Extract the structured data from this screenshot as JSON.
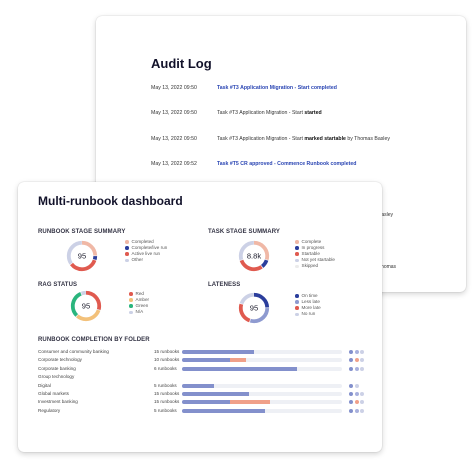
{
  "audit_log": {
    "title": "Audit Log",
    "entries": [
      {
        "date": "May 13, 2022 09:50",
        "text": "Task #T3 Application Migration - Start completed"
      },
      {
        "date": "May 13, 2022 09:50",
        "pre": "Task #T3 Application Migration - Start ",
        "bold": "started"
      },
      {
        "date": "May 13, 2022 09:50",
        "pre": "Task #T3 Application Migration - Start ",
        "bold": "marked startable",
        "post": " by Thomas Basley"
      },
      {
        "date": "May 13, 2022 09:52",
        "text": "Task #T5 CR approved - Commence Runbook completed"
      }
    ],
    "stub_1": "Basley",
    "stub_2": "Thomas"
  },
  "dashboard": {
    "title": "Multi-runbook dashboard",
    "runbook_stage": {
      "heading": "RUNBOOK STAGE SUMMARY",
      "value": "95",
      "legend": [
        "Completed",
        "Complete/live run",
        "Active live run",
        "Other"
      ],
      "colors": [
        "#f0b8a6",
        "#2b3e9c",
        "#e05a4f",
        "#ccd1e6"
      ],
      "fractions": [
        0.25,
        0.05,
        0.35,
        0.35
      ]
    },
    "task_stage": {
      "heading": "TASK STAGE SUMMARY",
      "value": "8.8k",
      "legend": [
        "Complete",
        "In progress",
        "Startable",
        "Not yet startable",
        "Skipped"
      ],
      "colors": [
        "#f0b8a6",
        "#2b3e9c",
        "#e05a4f",
        "#ccd1e6",
        "#ebebeb"
      ],
      "fractions": [
        0.3,
        0.1,
        0.3,
        0.3,
        0
      ]
    },
    "rag_status": {
      "heading": "RAG STATUS",
      "value": "95",
      "legend": [
        "Red",
        "Amber",
        "Green",
        "N/A"
      ],
      "colors": [
        "#e05a4f",
        "#f3c17a",
        "#2ab57d",
        "#ccd1e6"
      ],
      "fractions": [
        0.3,
        0.32,
        0.32,
        0.06
      ]
    },
    "lateness": {
      "heading": "LATENESS",
      "value": "95",
      "legend": [
        "On time",
        "Less late",
        "More late",
        "No run"
      ],
      "colors": [
        "#2b3e9c",
        "#8e9ad0",
        "#e05a4f",
        "#ccd1e6"
      ],
      "fractions": [
        0.25,
        0.3,
        0.25,
        0.2
      ]
    },
    "folders": {
      "heading": "RUNBOOK COMPLETION BY FOLDER",
      "rows": [
        {
          "name": "Consumer and community banking",
          "count": "15 runbooks",
          "segments": [
            {
              "v": 0.45,
              "c": "#8390cc"
            }
          ],
          "dots": [
            "#8390cc",
            "#a9b1dd",
            "#ccd1e6"
          ]
        },
        {
          "name": "Corporate technology",
          "count": "10 runbooks",
          "segments": [
            {
              "v": 0.3,
              "c": "#8390cc"
            },
            {
              "v": 0.1,
              "c": "#f0a089"
            }
          ],
          "dots": [
            "#8390cc",
            "#f0a089",
            "#ccd1e6"
          ]
        },
        {
          "name": "Corporate banking",
          "count": "6 runbooks",
          "segments": [
            {
              "v": 0.72,
              "c": "#8390cc"
            }
          ],
          "dots": [
            "#8390cc",
            "#a9b1dd",
            "#ccd1e6"
          ]
        },
        {
          "name": "Group technology",
          "count": "",
          "segments": [],
          "dots": []
        },
        {
          "name": "Digital",
          "count": "5 runbooks",
          "segments": [
            {
              "v": 0.2,
              "c": "#8390cc"
            }
          ],
          "dots": [
            "#8390cc",
            "#ccd1e6"
          ]
        },
        {
          "name": "Global markets",
          "count": "15 runbooks",
          "segments": [
            {
              "v": 0.42,
              "c": "#8390cc"
            }
          ],
          "dots": [
            "#8390cc",
            "#a9b1dd",
            "#ccd1e6"
          ]
        },
        {
          "name": "Investment banking",
          "count": "15 runbooks",
          "segments": [
            {
              "v": 0.3,
              "c": "#8390cc"
            },
            {
              "v": 0.25,
              "c": "#f0a089"
            }
          ],
          "dots": [
            "#8390cc",
            "#f0a089",
            "#ccd1e6"
          ]
        },
        {
          "name": "Regulatory",
          "count": "5 runbooks",
          "segments": [
            {
              "v": 0.52,
              "c": "#8390cc"
            }
          ],
          "dots": [
            "#8390cc",
            "#a9b1dd",
            "#ccd1e6"
          ]
        }
      ]
    }
  }
}
